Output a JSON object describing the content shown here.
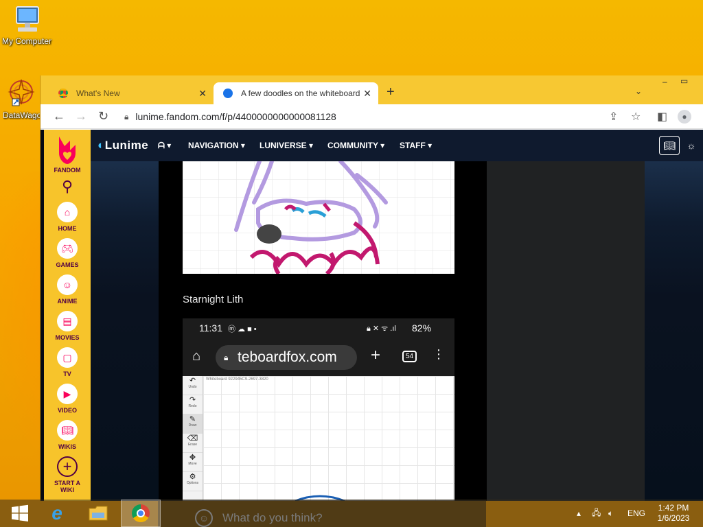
{
  "desktop": {
    "icons": [
      {
        "label": "My Computer"
      },
      {
        "label": "DataWagon"
      }
    ]
  },
  "browser": {
    "tabs": [
      {
        "title": "What's New",
        "active": false
      },
      {
        "title": "A few doodles on the whiteboard",
        "active": true
      }
    ],
    "url": "lunime.fandom.com/f/p/4400000000000081128"
  },
  "fandom_rail": {
    "brand": "FANDOM",
    "items": [
      {
        "label": "HOME",
        "icon": "home-icon"
      },
      {
        "label": "GAMES",
        "icon": "gamepad-icon"
      },
      {
        "label": "ANIME",
        "icon": "anime-icon"
      },
      {
        "label": "MOVIES",
        "icon": "movies-icon"
      },
      {
        "label": "TV",
        "icon": "tv-icon"
      },
      {
        "label": "VIDEO",
        "icon": "video-icon"
      },
      {
        "label": "WIKIS",
        "icon": "wikis-icon"
      }
    ],
    "start_wiki": "START A WIKI"
  },
  "wiki_header": {
    "logo": "Lunime",
    "nav": [
      "NAVIGATION",
      "LUNIVERSE",
      "COMMUNITY",
      "STAFF"
    ]
  },
  "post": {
    "caption": "Starnight Lith",
    "phone": {
      "time": "11:31",
      "battery": "82%",
      "url_fragment": "teboardfox.com",
      "tab_count": "54",
      "whiteboard_id": "Whiteboard 922945C9-2697-3820",
      "tools": [
        "Undo",
        "Redo",
        "Draw",
        "Erase",
        "Move",
        "Options"
      ]
    }
  },
  "comment": {
    "placeholder": "What do you think?"
  },
  "taskbar": {
    "language": "ENG",
    "time": "1:42 PM",
    "date": "1/6/2023"
  },
  "colors": {
    "fandom_rail": "#f7c42b",
    "fandom_pink": "#fa005a",
    "fandom_text": "#520044",
    "wiki_header": "#0f1a2e",
    "titlebar": "#f7c832"
  }
}
